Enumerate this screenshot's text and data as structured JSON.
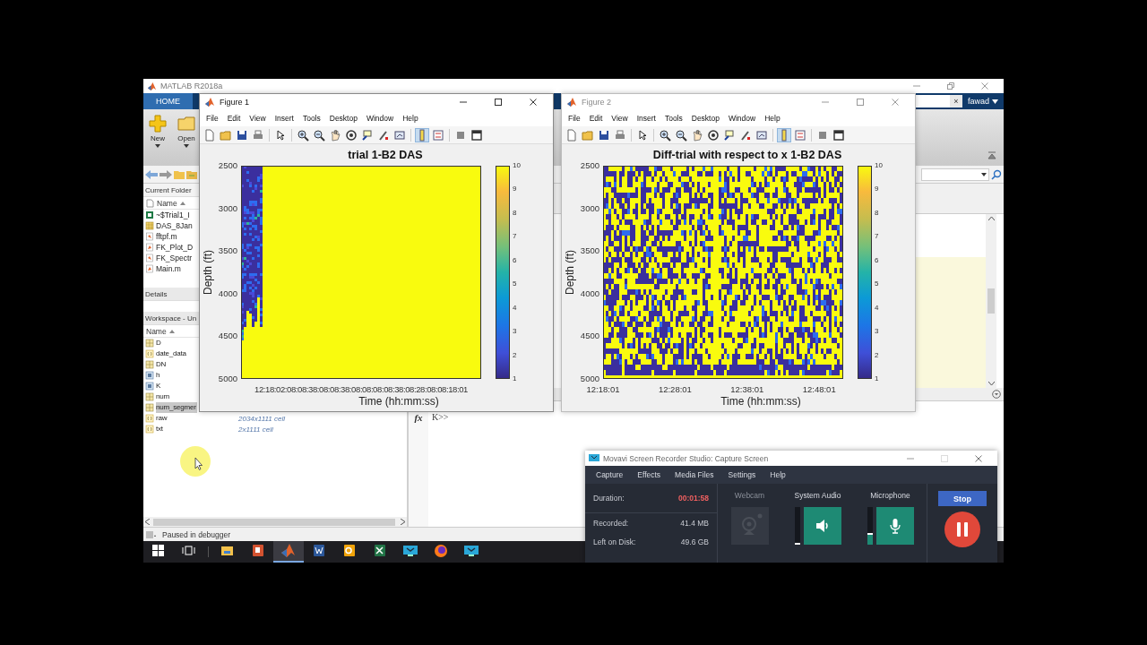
{
  "matlab": {
    "title": "MATLAB R2018a",
    "tabs": [
      {
        "label": "HOME",
        "selected": true
      }
    ],
    "search_clear": "×",
    "user": "fawad",
    "toolstrip": [
      {
        "label": "New",
        "kind": "new"
      },
      {
        "label": "Open",
        "kind": "open"
      }
    ],
    "current_folder": {
      "title": "Current Folder",
      "column": "Name",
      "files": [
        {
          "name": "~$Trial1_I",
          "kind": "excel"
        },
        {
          "name": "DAS_8Jan",
          "kind": "data"
        },
        {
          "name": "fftpf.m",
          "kind": "function"
        },
        {
          "name": "FK_Plot_D",
          "kind": "script"
        },
        {
          "name": "FK_Spectr",
          "kind": "function"
        },
        {
          "name": "Main.m",
          "kind": "script"
        }
      ]
    },
    "details": "Details",
    "workspace": {
      "title": "Workspace - Un",
      "column": "Name",
      "variables": [
        {
          "name": "D",
          "kind": "matrix",
          "selected": false
        },
        {
          "name": "date_data",
          "kind": "cell",
          "selected": false
        },
        {
          "name": "DN",
          "kind": "matrix",
          "selected": false
        },
        {
          "name": "h",
          "kind": "object",
          "selected": false
        },
        {
          "name": "K",
          "kind": "object",
          "selected": false
        },
        {
          "name": "num",
          "kind": "matrix",
          "selected": false
        },
        {
          "name": "num_segmer",
          "kind": "matrix",
          "selected": true
        },
        {
          "name": "raw",
          "kind": "cell",
          "selected": false,
          "value": "2034x1111 cell"
        },
        {
          "name": "txt",
          "kind": "cell",
          "selected": false,
          "value": "2x1111 cell"
        }
      ]
    },
    "command": {
      "prompt_icon": "fx",
      "prompt": "K>>"
    },
    "status": "Paused in debugger"
  },
  "figures": [
    {
      "title": "Figure 1",
      "active": true,
      "menus": [
        "File",
        "Edit",
        "View",
        "Insert",
        "Tools",
        "Desktop",
        "Window",
        "Help"
      ],
      "toolbar": [
        {
          "kind": "new",
          "pressed": false
        },
        {
          "kind": "open",
          "pressed": false
        },
        {
          "kind": "save",
          "pressed": false
        },
        {
          "kind": "print",
          "pressed": false
        },
        {
          "kind": "pointer",
          "pressed": false
        },
        {
          "kind": "zoomin",
          "pressed": false
        },
        {
          "kind": "zoomout",
          "pressed": false
        },
        {
          "kind": "pan",
          "pressed": false
        },
        {
          "kind": "rotate",
          "pressed": false
        },
        {
          "kind": "datacursor",
          "pressed": false
        },
        {
          "kind": "brush",
          "pressed": false
        },
        {
          "kind": "link",
          "pressed": false
        },
        {
          "kind": "colorbar",
          "pressed": true
        },
        {
          "kind": "legend",
          "pressed": false
        },
        {
          "kind": "hide",
          "pressed": false
        },
        {
          "kind": "show",
          "pressed": false
        }
      ],
      "plot": {
        "title": "trial 1-B2 DAS",
        "kind": "onset",
        "ylabel": "Depth (ft)",
        "yticks": [
          "2500",
          "3000",
          "3500",
          "4000",
          "4500",
          "5000"
        ],
        "xticks": [
          "12:18:02:08:08:38:08:08:38:08:08:08:08:38:08:28:08:08:18:01"
        ],
        "xlabel": "Time (hh:mm:ss)",
        "colorbar": [
          "10",
          "9",
          "8",
          "7",
          "6",
          "5",
          "4",
          "3",
          "2",
          "1"
        ]
      }
    },
    {
      "title": "Figure 2",
      "active": false,
      "menus": [
        "File",
        "Edit",
        "View",
        "Insert",
        "Tools",
        "Desktop",
        "Window",
        "Help"
      ],
      "toolbar": [
        {
          "kind": "new",
          "pressed": false
        },
        {
          "kind": "open",
          "pressed": false
        },
        {
          "kind": "save",
          "pressed": false
        },
        {
          "kind": "print",
          "pressed": false
        },
        {
          "kind": "pointer",
          "pressed": false
        },
        {
          "kind": "zoomin",
          "pressed": false
        },
        {
          "kind": "zoomout",
          "pressed": false
        },
        {
          "kind": "pan",
          "pressed": false
        },
        {
          "kind": "rotate",
          "pressed": false
        },
        {
          "kind": "datacursor",
          "pressed": false
        },
        {
          "kind": "brush",
          "pressed": false
        },
        {
          "kind": "link",
          "pressed": false
        },
        {
          "kind": "colorbar",
          "pressed": true
        },
        {
          "kind": "legend",
          "pressed": false
        },
        {
          "kind": "hide",
          "pressed": false
        },
        {
          "kind": "show",
          "pressed": false
        }
      ],
      "plot": {
        "title": "Diff-trial with respect to x 1-B2 DAS",
        "kind": "noise",
        "ylabel": "Depth (ft)",
        "yticks": [
          "2500",
          "3000",
          "3500",
          "4000",
          "4500",
          "5000"
        ],
        "xticks": [
          "12:18:01",
          "12:28:01",
          "12:38:01",
          "12:48:01"
        ],
        "xlabel": "Time (hh:mm:ss)",
        "colorbar": [
          "10",
          "9",
          "8",
          "7",
          "6",
          "5",
          "4",
          "3",
          "2",
          "1"
        ]
      }
    }
  ],
  "recorder": {
    "title": "Movavi Screen Recorder Studio: Capture Screen",
    "menus": [
      "Capture",
      "Effects",
      "Media Files",
      "Settings",
      "Help"
    ],
    "stats": [
      {
        "label": "Duration:",
        "value": "00:01:58",
        "kind": "timer"
      },
      {
        "label": "Recorded:",
        "value": "41.4 MB",
        "kind": "size"
      },
      {
        "label": "Left on Disk:",
        "value": "49.6 GB",
        "kind": "size"
      }
    ],
    "sources": [
      {
        "label": "Webcam",
        "kind": "webcam",
        "on": false
      },
      {
        "label": "System Audio",
        "kind": "speaker",
        "on": true,
        "level": 0.03
      },
      {
        "label": "Microphone",
        "kind": "mic",
        "on": true,
        "level": 0.3
      }
    ],
    "stop": "Stop"
  },
  "taskbar": [
    {
      "kind": "start",
      "selected": false
    },
    {
      "kind": "taskview",
      "selected": false
    },
    {
      "kind": "explorer",
      "selected": false
    },
    {
      "kind": "powerpoint",
      "selected": false
    },
    {
      "kind": "matlab",
      "selected": true
    },
    {
      "kind": "word",
      "selected": false
    },
    {
      "kind": "outlook",
      "selected": false
    },
    {
      "kind": "excel",
      "selected": false
    },
    {
      "kind": "recorder",
      "selected": false
    },
    {
      "kind": "firefox",
      "selected": false
    },
    {
      "kind": "recorder",
      "selected": false
    }
  ]
}
